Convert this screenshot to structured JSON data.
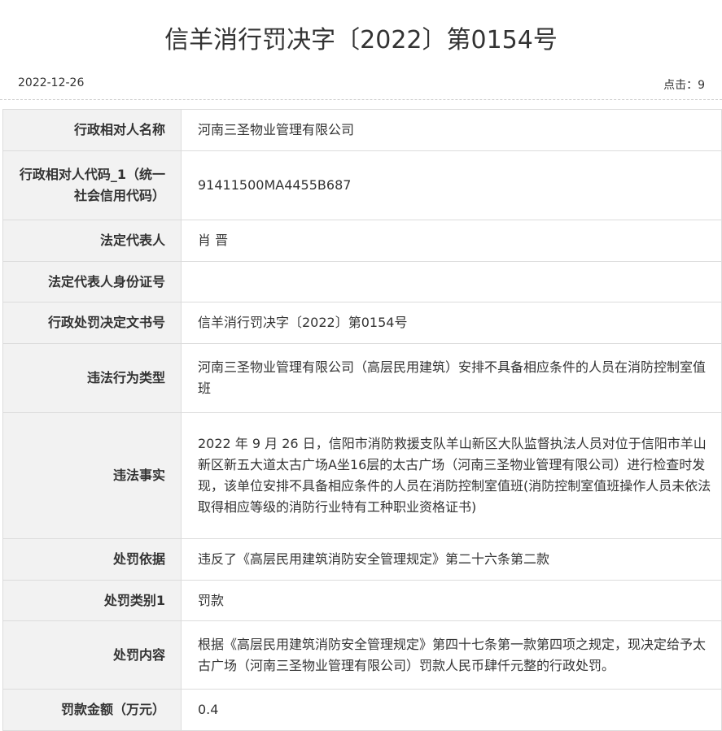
{
  "header": {
    "title": "信羊消行罚决字〔2022〕第0154号",
    "date": "2022-12-26",
    "clicks_label": "点击：",
    "clicks_value": "9"
  },
  "rows": [
    {
      "label": "行政相对人名称",
      "value": "河南三圣物业管理有限公司"
    },
    {
      "label": "行政相对人代码_1（统一社会信用代码）",
      "value": "91411500MA4455B687"
    },
    {
      "label": "法定代表人",
      "value": "肖 晋"
    },
    {
      "label": "法定代表人身份证号",
      "value": ""
    },
    {
      "label": "行政处罚决定文书号",
      "value": "信羊消行罚决字〔2022〕第0154号"
    },
    {
      "label": "违法行为类型",
      "value": "河南三圣物业管理有限公司（高层民用建筑）安排不具备相应条件的人员在消防控制室值班"
    },
    {
      "label": "违法事实",
      "value": "2022 年 9 月 26 日，信阳市消防救援支队羊山新区大队监督执法人员对位于信阳市羊山新区新五大道太古广场A坐16层的太古广场（河南三圣物业管理有限公司）进行检查时发现，该单位安排不具备相应条件的人员在消防控制室值班(消防控制室值班操作人员未依法取得相应等级的消防行业特有工种职业资格证书)"
    },
    {
      "label": "处罚依据",
      "value": "违反了《高层民用建筑消防安全管理规定》第二十六条第二款"
    },
    {
      "label": "处罚类别1",
      "value": "罚款"
    },
    {
      "label": "处罚内容",
      "value": "根据《高层民用建筑消防安全管理规定》第四十七条第一款第四项之规定，现决定给予太古广场（河南三圣物业管理有限公司）罚款人民币肆仟元整的行政处罚。"
    },
    {
      "label": "罚款金额（万元）",
      "value": "0.4"
    }
  ]
}
